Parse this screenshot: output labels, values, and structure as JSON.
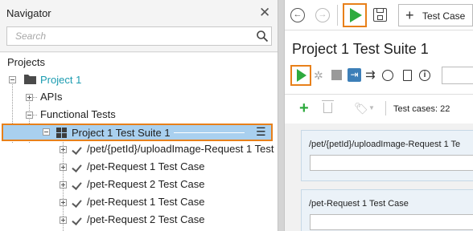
{
  "navigator": {
    "title": "Navigator",
    "search_placeholder": "Search",
    "tree": {
      "root_label": "Projects",
      "project": "Project 1",
      "apis": "APIs",
      "functional_tests": "Functional Tests",
      "suite": "Project 1 Test Suite 1",
      "test_cases": [
        "/pet/{petId}/uploadImage-Request 1 Test",
        "/pet-Request 1 Test Case",
        "/pet-Request 2 Test Case",
        "/pet-Request 1 Test Case",
        "/pet-Request 2 Test Case"
      ]
    }
  },
  "toolbar": {
    "add_test_case_label": "Test Case"
  },
  "editor": {
    "suite_title": "Project 1 Test Suite 1",
    "test_case_count": "Test cases: 22",
    "cases": [
      "/pet/{petId}/uploadImage-Request 1 Te",
      "/pet-Request 1 Test Case"
    ]
  },
  "colors": {
    "highlight_border": "#e8801a",
    "selection_bg": "#a9d0ef",
    "run_green": "#2eaa3e",
    "project_link": "#1a9bb0"
  }
}
